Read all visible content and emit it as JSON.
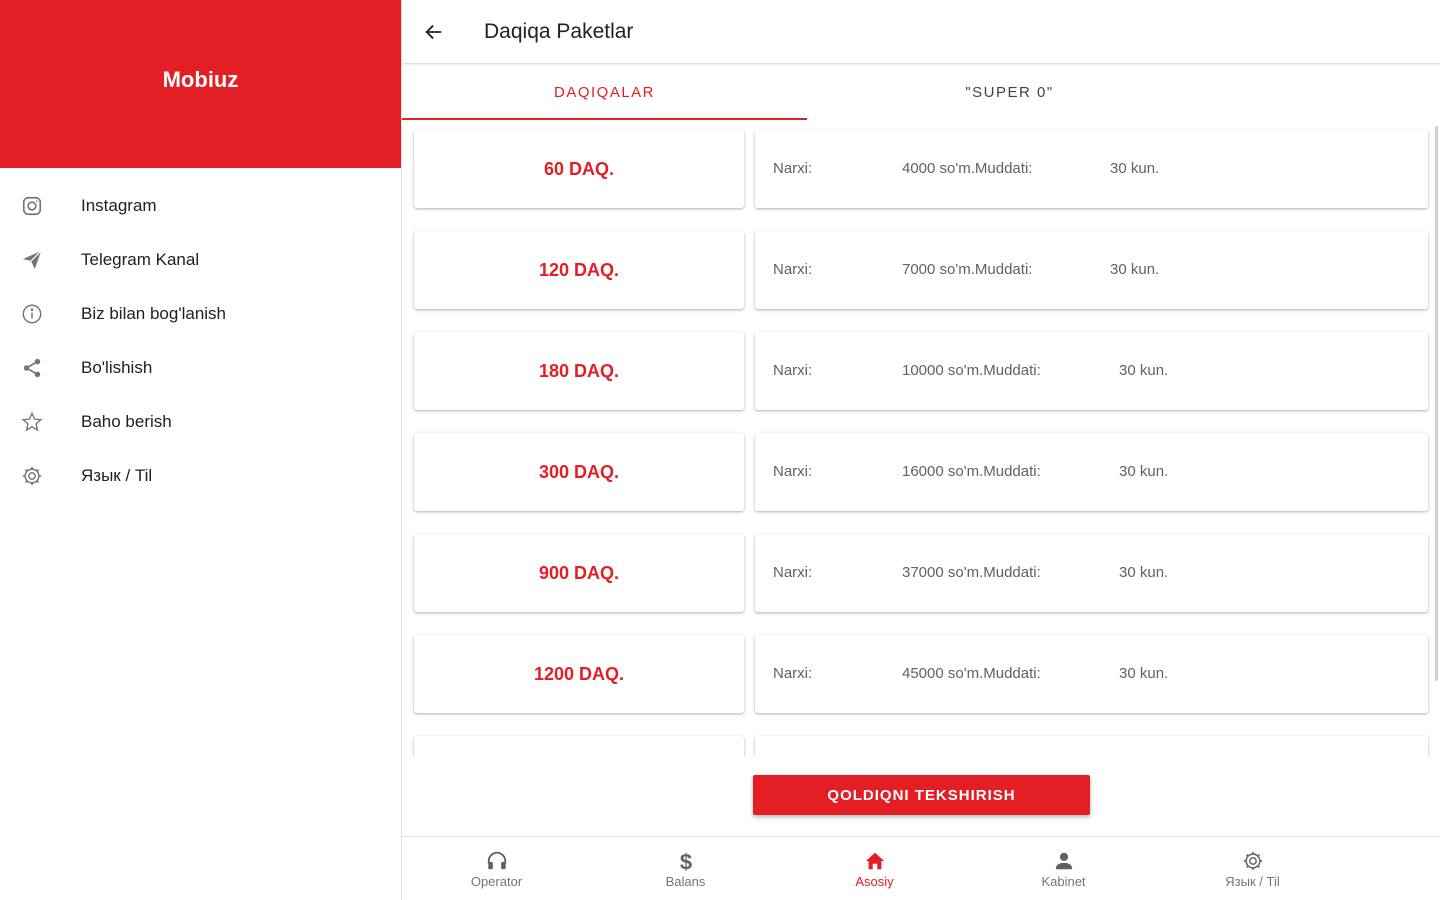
{
  "colors": {
    "accent": "#e31e24",
    "text": "#212121",
    "muted": "#757575"
  },
  "drawer": {
    "title": "Mobiuz",
    "items": [
      {
        "label": "Instagram",
        "icon": "instagram-icon"
      },
      {
        "label": "Telegram Kanal",
        "icon": "send-icon"
      },
      {
        "label": "Biz bilan bog'lanish",
        "icon": "info-icon"
      },
      {
        "label": "Bo'lishish",
        "icon": "share-icon"
      },
      {
        "label": "Baho berish",
        "icon": "star-icon"
      },
      {
        "label": "Язык / Til",
        "icon": "gear-icon"
      }
    ]
  },
  "appbar": {
    "title": "Daqiqa Paketlar",
    "back_icon": "arrow-back-icon"
  },
  "tabs": [
    {
      "label": "DAQIQALAR",
      "active": true
    },
    {
      "label": "\"SUPER 0\"",
      "active": false
    }
  ],
  "packages": [
    {
      "name": "60 DAQ.",
      "price_label": "Narxi:",
      "price": "4000 so'm.",
      "duration_label": "Muddati:",
      "duration": "30 kun."
    },
    {
      "name": "120 DAQ.",
      "price_label": "Narxi:",
      "price": "7000 so'm.",
      "duration_label": "Muddati:",
      "duration": "30 kun."
    },
    {
      "name": "180 DAQ.",
      "price_label": "Narxi:",
      "price": "10000 so'm.",
      "duration_label": "Muddati:",
      "duration": "30 kun."
    },
    {
      "name": "300 DAQ.",
      "price_label": "Narxi:",
      "price": "16000 so'm.",
      "duration_label": "Muddati:",
      "duration": "30 kun."
    },
    {
      "name": "900 DAQ.",
      "price_label": "Narxi:",
      "price": "37000 so'm.",
      "duration_label": "Muddati:",
      "duration": "30 kun."
    },
    {
      "name": "1200 DAQ.",
      "price_label": "Narxi:",
      "price": "45000 so'm.",
      "duration_label": "Muddati:",
      "duration": "30 kun."
    }
  ],
  "check_button": "QOLDIQNI TEKSHIRISH",
  "bottom_nav": [
    {
      "label": "Operator",
      "icon": "headset-icon",
      "active": false
    },
    {
      "label": "Balans",
      "icon": "dollar-icon",
      "active": false
    },
    {
      "label": "Asosiy",
      "icon": "home-icon",
      "active": true
    },
    {
      "label": "Kabinet",
      "icon": "person-icon",
      "active": false
    },
    {
      "label": "Язык / Til",
      "icon": "gear-icon",
      "active": false
    }
  ]
}
